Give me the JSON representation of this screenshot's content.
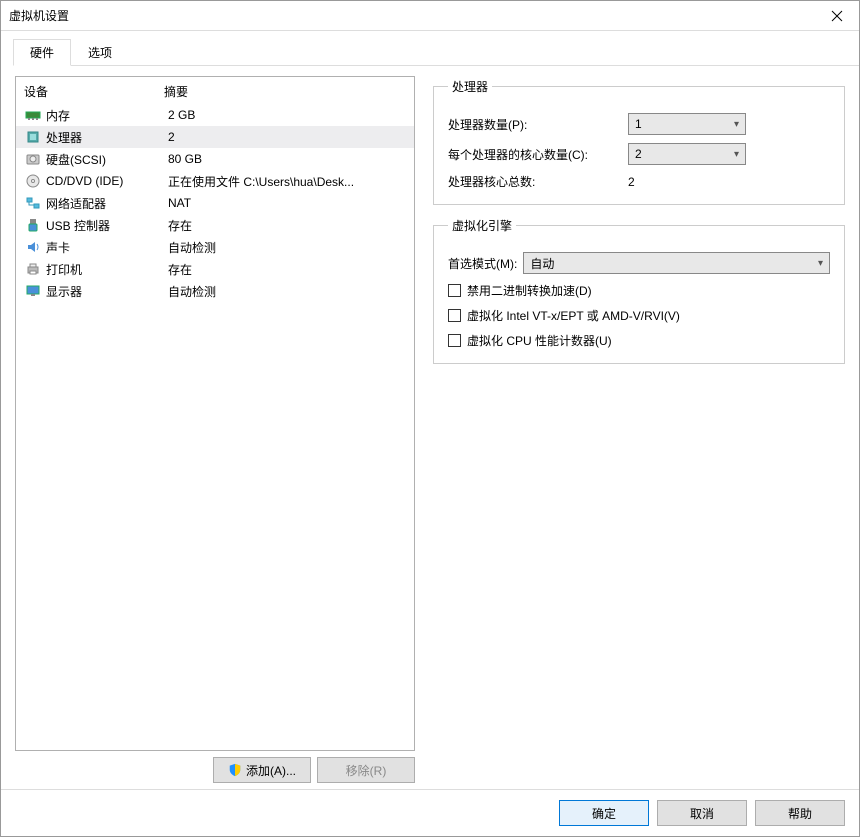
{
  "title": "虚拟机设置",
  "tabs": {
    "hardware": "硬件",
    "options": "选项"
  },
  "hw": {
    "head_device": "设备",
    "head_summary": "摘要",
    "rows": [
      {
        "name": "内存",
        "summary": "2 GB",
        "icon": "memory"
      },
      {
        "name": "处理器",
        "summary": "2",
        "icon": "cpu",
        "selected": true
      },
      {
        "name": "硬盘(SCSI)",
        "summary": "80 GB",
        "icon": "disk"
      },
      {
        "name": "CD/DVD (IDE)",
        "summary": "正在使用文件 C:\\Users\\hua\\Desk...",
        "icon": "cd"
      },
      {
        "name": "网络适配器",
        "summary": "NAT",
        "icon": "net"
      },
      {
        "name": "USB 控制器",
        "summary": "存在",
        "icon": "usb"
      },
      {
        "name": "声卡",
        "summary": "自动检测",
        "icon": "sound"
      },
      {
        "name": "打印机",
        "summary": "存在",
        "icon": "printer"
      },
      {
        "name": "显示器",
        "summary": "自动检测",
        "icon": "display"
      }
    ],
    "add_btn": "添加(A)...",
    "remove_btn": "移除(R)"
  },
  "proc": {
    "legend": "处理器",
    "count_label": "处理器数量(P):",
    "count_value": "1",
    "cores_label": "每个处理器的核心数量(C):",
    "cores_value": "2",
    "total_label": "处理器核心总数:",
    "total_value": "2"
  },
  "virt": {
    "legend": "虚拟化引擎",
    "pref_mode_label": "首选模式(M):",
    "pref_mode_value": "自动",
    "chk1": "禁用二进制转换加速(D)",
    "chk2": "虚拟化 Intel VT-x/EPT 或 AMD-V/RVI(V)",
    "chk3": "虚拟化 CPU 性能计数器(U)"
  },
  "buttons": {
    "ok": "确定",
    "cancel": "取消",
    "help": "帮助"
  }
}
